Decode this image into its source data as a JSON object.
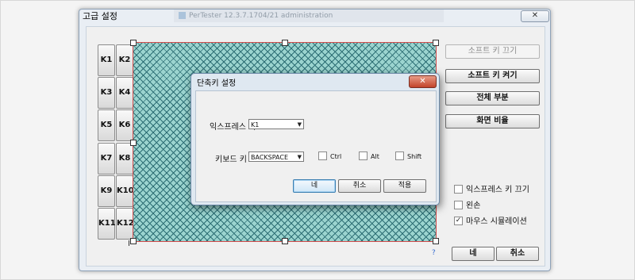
{
  "dialog": {
    "title": "고급 설정",
    "close_icon": "close-icon"
  },
  "background_app": {
    "title": "PerTester 12.3.7.1704/21 administration"
  },
  "keys": [
    "K1",
    "K2",
    "K3",
    "K4",
    "K5",
    "K6",
    "K7",
    "K8",
    "K9",
    "K10",
    "K11",
    "K12"
  ],
  "right_panel": {
    "soft_key_off": "소프트 키 끄기",
    "soft_key_on": "소프트 키 켜기",
    "full_part": "전체 부분",
    "screen_ratio": "화면 비율"
  },
  "options": {
    "express_key_off": {
      "label": "익스프레스 키 끄기",
      "checked": false
    },
    "left_hand": {
      "label": "왼손",
      "checked": false
    },
    "mouse_sim": {
      "label": "마우스 시뮬레이션",
      "checked": true
    }
  },
  "help": "?",
  "footer": {
    "ok": "네",
    "cancel": "취소"
  },
  "shortcut_dialog": {
    "title": "단축키 설정",
    "express_label": "익스프레스 키",
    "express_value": "K1",
    "keyboard_label": "키보드 키",
    "keyboard_value": "BACKSPACE",
    "mods": [
      "Ctrl",
      "Alt",
      "Shift"
    ],
    "ok": "네",
    "cancel": "취소",
    "apply": "적용"
  }
}
